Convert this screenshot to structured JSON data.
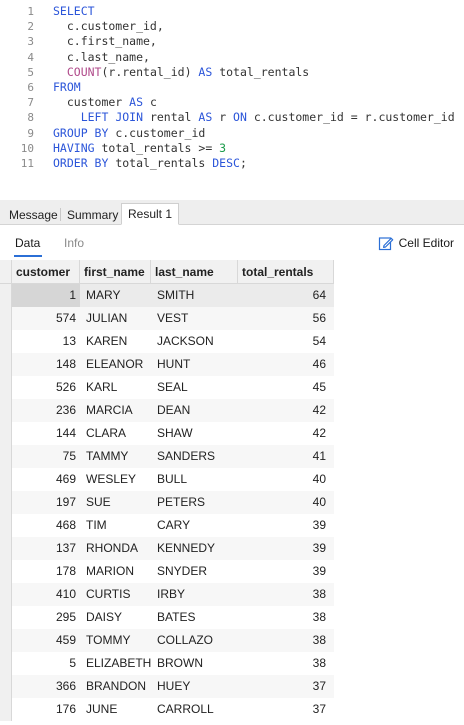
{
  "editor": {
    "lines": [
      {
        "n": "1",
        "tokens": [
          {
            "t": "SELECT",
            "c": "kw"
          }
        ]
      },
      {
        "n": "2",
        "tokens": [
          {
            "t": "  c.customer_id,",
            "c": "id"
          }
        ]
      },
      {
        "n": "3",
        "tokens": [
          {
            "t": "  c.first_name,",
            "c": "id"
          }
        ]
      },
      {
        "n": "4",
        "tokens": [
          {
            "t": "  c.last_name,",
            "c": "id"
          }
        ]
      },
      {
        "n": "5",
        "tokens": [
          {
            "t": "  ",
            "c": "id"
          },
          {
            "t": "COUNT",
            "c": "fn"
          },
          {
            "t": "(r.rental_id) ",
            "c": "id"
          },
          {
            "t": "AS",
            "c": "kw"
          },
          {
            "t": " total_rentals",
            "c": "id"
          }
        ]
      },
      {
        "n": "6",
        "tokens": [
          {
            "t": "FROM",
            "c": "kw"
          }
        ]
      },
      {
        "n": "7",
        "tokens": [
          {
            "t": "  customer ",
            "c": "id"
          },
          {
            "t": "AS",
            "c": "kw"
          },
          {
            "t": " c",
            "c": "id"
          }
        ]
      },
      {
        "n": "8",
        "tokens": [
          {
            "t": "    ",
            "c": "id"
          },
          {
            "t": "LEFT JOIN",
            "c": "kw"
          },
          {
            "t": " rental ",
            "c": "id"
          },
          {
            "t": "AS",
            "c": "kw"
          },
          {
            "t": " r ",
            "c": "id"
          },
          {
            "t": "ON",
            "c": "kw"
          },
          {
            "t": " c.customer_id = r.customer_id",
            "c": "id"
          }
        ]
      },
      {
        "n": "9",
        "tokens": [
          {
            "t": "GROUP BY",
            "c": "kw"
          },
          {
            "t": " c.customer_id",
            "c": "id"
          }
        ]
      },
      {
        "n": "10",
        "tokens": [
          {
            "t": "HAVING",
            "c": "kw"
          },
          {
            "t": " total_rentals >= ",
            "c": "id"
          },
          {
            "t": "3",
            "c": "num"
          }
        ]
      },
      {
        "n": "11",
        "tokens": [
          {
            "t": "ORDER BY",
            "c": "kw"
          },
          {
            "t": " total_rentals ",
            "c": "id"
          },
          {
            "t": "DESC",
            "c": "kw"
          },
          {
            "t": ";",
            "c": "id"
          }
        ]
      }
    ]
  },
  "result_tabs": {
    "message": "Message",
    "summary": "Summary",
    "result1": "Result 1"
  },
  "sub_tabs": {
    "data": "Data",
    "info": "Info",
    "cell_editor": "Cell Editor"
  },
  "grid": {
    "columns": [
      "customer",
      "first_name",
      "last_name",
      "total_rentals"
    ],
    "rows": [
      [
        "1",
        "MARY",
        "SMITH",
        "64"
      ],
      [
        "574",
        "JULIAN",
        "VEST",
        "56"
      ],
      [
        "13",
        "KAREN",
        "JACKSON",
        "54"
      ],
      [
        "148",
        "ELEANOR",
        "HUNT",
        "46"
      ],
      [
        "526",
        "KARL",
        "SEAL",
        "45"
      ],
      [
        "236",
        "MARCIA",
        "DEAN",
        "42"
      ],
      [
        "144",
        "CLARA",
        "SHAW",
        "42"
      ],
      [
        "75",
        "TAMMY",
        "SANDERS",
        "41"
      ],
      [
        "469",
        "WESLEY",
        "BULL",
        "40"
      ],
      [
        "197",
        "SUE",
        "PETERS",
        "40"
      ],
      [
        "468",
        "TIM",
        "CARY",
        "39"
      ],
      [
        "137",
        "RHONDA",
        "KENNEDY",
        "39"
      ],
      [
        "178",
        "MARION",
        "SNYDER",
        "39"
      ],
      [
        "410",
        "CURTIS",
        "IRBY",
        "38"
      ],
      [
        "295",
        "DAISY",
        "BATES",
        "38"
      ],
      [
        "459",
        "TOMMY",
        "COLLAZO",
        "38"
      ],
      [
        "5",
        "ELIZABETH",
        "BROWN",
        "38"
      ],
      [
        "366",
        "BRANDON",
        "HUEY",
        "37"
      ],
      [
        "176",
        "JUNE",
        "CARROLL",
        "37"
      ]
    ]
  },
  "colors": {
    "keyword": "#2b55d9",
    "function": "#b04a8a",
    "number": "#1a9a4a",
    "accent": "#2b6fd6"
  }
}
